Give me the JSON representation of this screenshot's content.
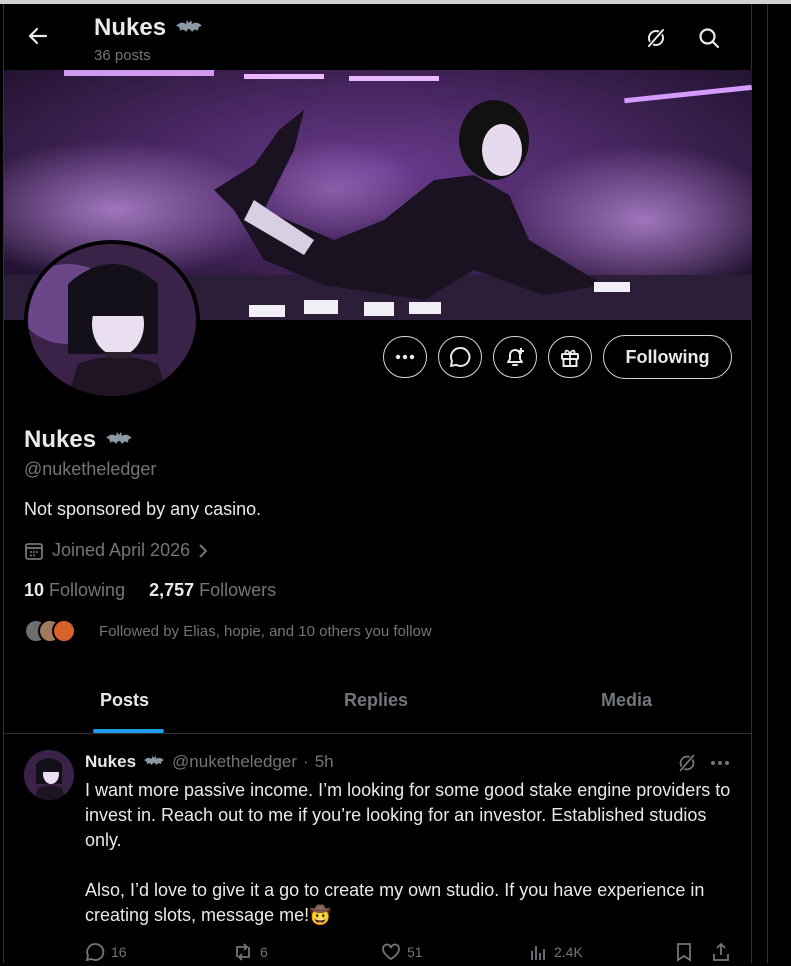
{
  "header": {
    "title": "Nukes",
    "badge_icon": "bat-emoji-icon",
    "post_count": "36 posts"
  },
  "profile": {
    "name": "Nukes",
    "handle": "@nuketheledger",
    "bio": "Not sponsored by any casino.",
    "joined": "Joined April 2026",
    "following_count": "10",
    "following_label": "Following",
    "followers_count": "2,757",
    "followers_label": "Followers",
    "followed_by": "Followed by Elias, hopie, and 10 others you follow",
    "follow_button": "Following"
  },
  "tabs": [
    {
      "label": "Posts",
      "active": true
    },
    {
      "label": "Replies",
      "active": false
    },
    {
      "label": "Media",
      "active": false
    }
  ],
  "post": {
    "author": "Nukes",
    "handle": "@nuketheledger",
    "dot": "·",
    "time": "5h",
    "paragraph1": "I want more passive income. I’m looking for some good stake engine providers to invest in. Reach out to me if you’re looking for an investor. Established studios only.",
    "paragraph2": "Also, I’d love to give it a go to create my own studio. If you have experience in creating slots, message me!🤠",
    "replies": "16",
    "reposts": "6",
    "likes": "51",
    "views": "2.4K"
  },
  "colors": {
    "accent": "#1d9bf0",
    "muted": "#71767b",
    "text": "#e7e9ea",
    "border": "#2f3336"
  }
}
